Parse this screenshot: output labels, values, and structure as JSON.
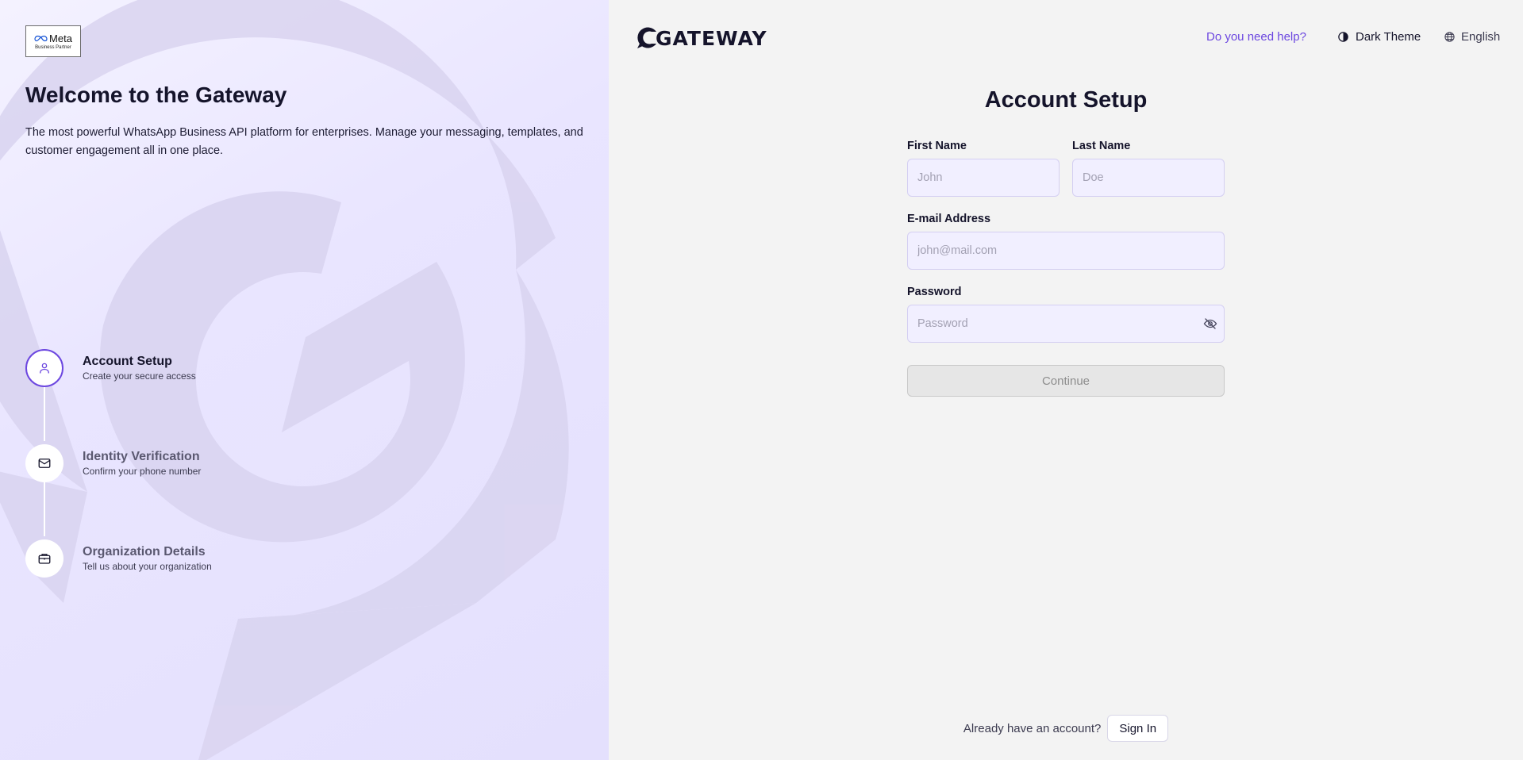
{
  "left": {
    "badge": {
      "brand": "Meta",
      "sub": "Business Partner"
    },
    "title": "Welcome to the Gateway",
    "description": "The most powerful WhatsApp Business API platform for enterprises. Manage your messaging, templates, and customer engagement all in one place.",
    "steps": [
      {
        "title": "Account Setup",
        "subtitle": "Create your secure access",
        "icon": "user-icon",
        "active": true
      },
      {
        "title": "Identity Verification",
        "subtitle": "Confirm your phone number",
        "icon": "mail-icon",
        "active": false
      },
      {
        "title": "Organization Details",
        "subtitle": "Tell us about your organization",
        "icon": "briefcase-icon",
        "active": false
      }
    ]
  },
  "header": {
    "brand": "GATEWAY",
    "help": "Do you need help?",
    "theme": "Dark Theme",
    "language": "English"
  },
  "form": {
    "title": "Account Setup",
    "first_name": {
      "label": "First Name",
      "placeholder": "John",
      "value": ""
    },
    "last_name": {
      "label": "Last Name",
      "placeholder": "Doe",
      "value": ""
    },
    "email": {
      "label": "E-mail Address",
      "placeholder": "john@mail.com",
      "value": ""
    },
    "password": {
      "label": "Password",
      "placeholder": "Password",
      "value": ""
    },
    "continue": "Continue"
  },
  "footer": {
    "question": "Already have an account?",
    "signin": "Sign In"
  },
  "colors": {
    "accent": "#6c47e0",
    "panel": "#e9e5ff",
    "background": "#f3f3f3"
  }
}
